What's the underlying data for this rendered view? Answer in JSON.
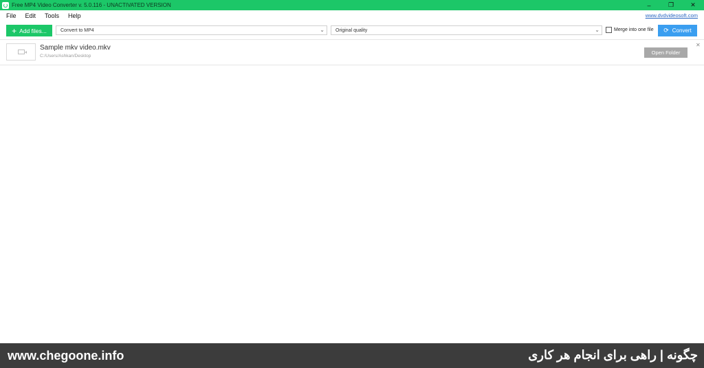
{
  "window": {
    "title": "Free MP4 Video Converter v. 5.0.116 - UNACTIVATED VERSION",
    "controls": {
      "minimize": "–",
      "maximize": "❐",
      "close": "✕"
    }
  },
  "menu": {
    "items": [
      "File",
      "Edit",
      "Tools",
      "Help"
    ],
    "site_link": "www.dvdvideosoft.com"
  },
  "toolbar": {
    "add_files_label": "Add files...",
    "format_value": "Convert to MP4",
    "quality_value": "Original quality",
    "merge_label": "Merge into one file",
    "merge_checked": false,
    "convert_label": "Convert"
  },
  "files": [
    {
      "name": "Sample mkv video.mkv",
      "path": "C:/Users/Ashkan/Desktop",
      "open_folder_label": "Open Folder",
      "remove_glyph": "✕"
    }
  ],
  "footer": {
    "left_text": "www.chegoone.info",
    "right_text": "چگونه | راهی برای انجام هر کاری"
  },
  "colors": {
    "accent_green": "#1cc768",
    "convert_blue": "#3a9ef0",
    "footer_bg": "#3c3c3c"
  }
}
